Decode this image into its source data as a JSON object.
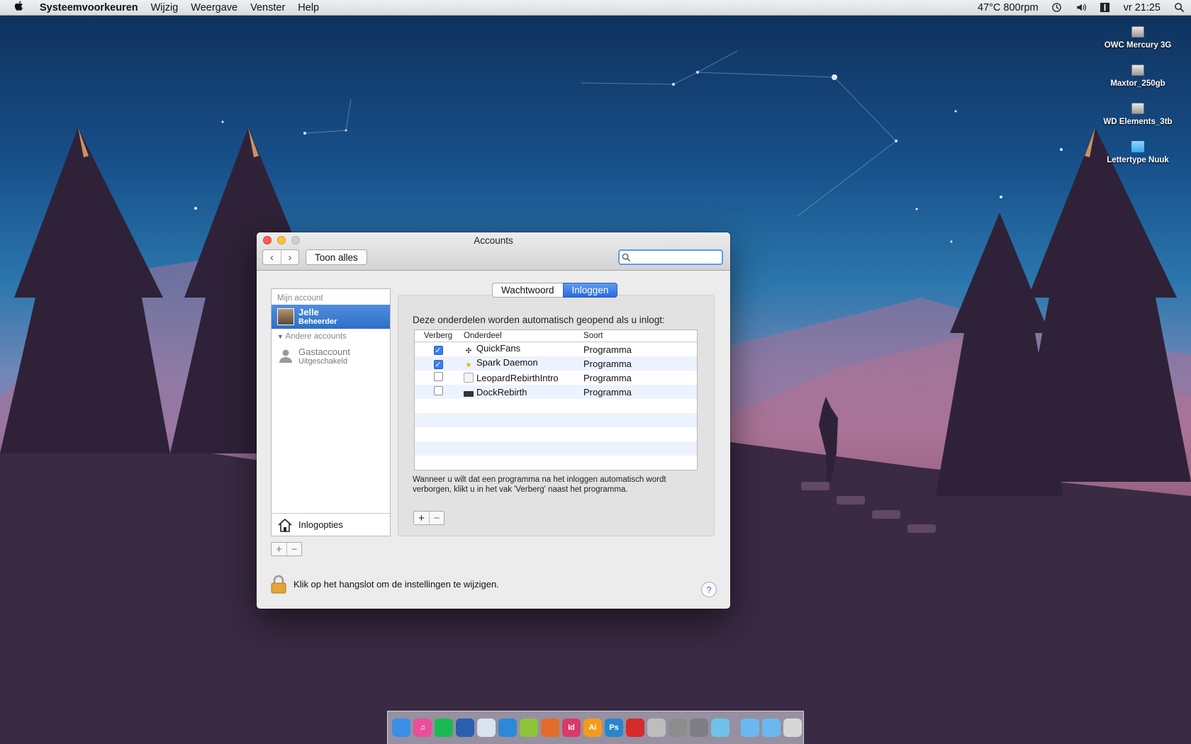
{
  "menubar": {
    "app": "Systeemvoorkeuren",
    "items": [
      "Wijzig",
      "Weergave",
      "Venster",
      "Help"
    ],
    "status": "47°C 800rpm",
    "clock": "vr 21:25"
  },
  "desktop": {
    "icons": [
      {
        "label": "OWC Mercury 3G",
        "icon": "drive-icon"
      },
      {
        "label": "Maxtor_250gb",
        "icon": "drive-icon"
      },
      {
        "label": "WD Elements_3tb",
        "icon": "external-drive-icon"
      },
      {
        "label": "Lettertype Nuuk",
        "icon": "folder-icon"
      }
    ]
  },
  "window": {
    "title": "Accounts",
    "show_all": "Toon alles",
    "search_placeholder": "",
    "sidebar": {
      "my_account_header": "Mijn account",
      "selected": {
        "name": "Jelle",
        "role": "Beheerder"
      },
      "other_header": "Andere accounts",
      "guest": {
        "name": "Gastaccount",
        "status": "Uitgeschakeld"
      },
      "login_options": "Inlogopties"
    },
    "tabs": [
      "Wachtwoord",
      "Inloggen"
    ],
    "active_tab": "Inloggen",
    "intro": "Deze onderdelen worden automatisch geopend als u inlogt:",
    "table": {
      "headers": [
        "Verberg",
        "Onderdeel",
        "Soort"
      ],
      "rows": [
        {
          "hide": true,
          "item": "QuickFans",
          "kind": "Programma",
          "icon": "fan-icon"
        },
        {
          "hide": true,
          "item": "Spark Daemon",
          "kind": "Programma",
          "icon": "star-icon"
        },
        {
          "hide": false,
          "item": "LeopardRebirthIntro",
          "kind": "Programma",
          "icon": "app-icon"
        },
        {
          "hide": false,
          "item": "DockRebirth",
          "kind": "Programma",
          "icon": "dock-icon"
        }
      ]
    },
    "hint": "Wanneer u wilt dat een programma na het inloggen automatisch wordt verborgen, klikt u in het vak 'Verberg' naast het programma.",
    "lock_text": "Klik op het hangslot om de instellingen te wijzigen.",
    "help": "?"
  },
  "dock": {
    "apps": [
      {
        "name": "Finder",
        "label": "",
        "color": "#3b8fe6"
      },
      {
        "name": "iTunes",
        "label": "♫",
        "color": "#e94f9a"
      },
      {
        "name": "Spotify",
        "label": "",
        "color": "#1db954"
      },
      {
        "name": "Globe",
        "label": "",
        "color": "#2a5fb0"
      },
      {
        "name": "Preview",
        "label": "",
        "color": "#d7e4ef"
      },
      {
        "name": "Xcode",
        "label": "",
        "color": "#2d88d8"
      },
      {
        "name": "Dreamweaver",
        "label": "",
        "color": "#8fc43a"
      },
      {
        "name": "Firefox",
        "label": "",
        "color": "#e36b2a"
      },
      {
        "name": "InDesign",
        "label": "Id",
        "color": "#d83a6a"
      },
      {
        "name": "Illustrator",
        "label": "Ai",
        "color": "#f29b1d"
      },
      {
        "name": "Photoshop",
        "label": "Ps",
        "color": "#2a84c9"
      },
      {
        "name": "Acrobat",
        "label": "",
        "color": "#d42b2b"
      },
      {
        "name": "Archive",
        "label": "",
        "color": "#bdbdbd"
      },
      {
        "name": "Utility",
        "label": "",
        "color": "#8d8d8d"
      },
      {
        "name": "System Preferences",
        "label": "",
        "color": "#7d7f85"
      },
      {
        "name": "App Store",
        "label": "",
        "color": "#6fc2e8"
      }
    ],
    "stacks": [
      {
        "name": "Folder",
        "color": "#6ab8ef"
      },
      {
        "name": "Folder",
        "color": "#6ab8ef"
      },
      {
        "name": "Trash",
        "color": "#d7d7d7"
      }
    ]
  }
}
